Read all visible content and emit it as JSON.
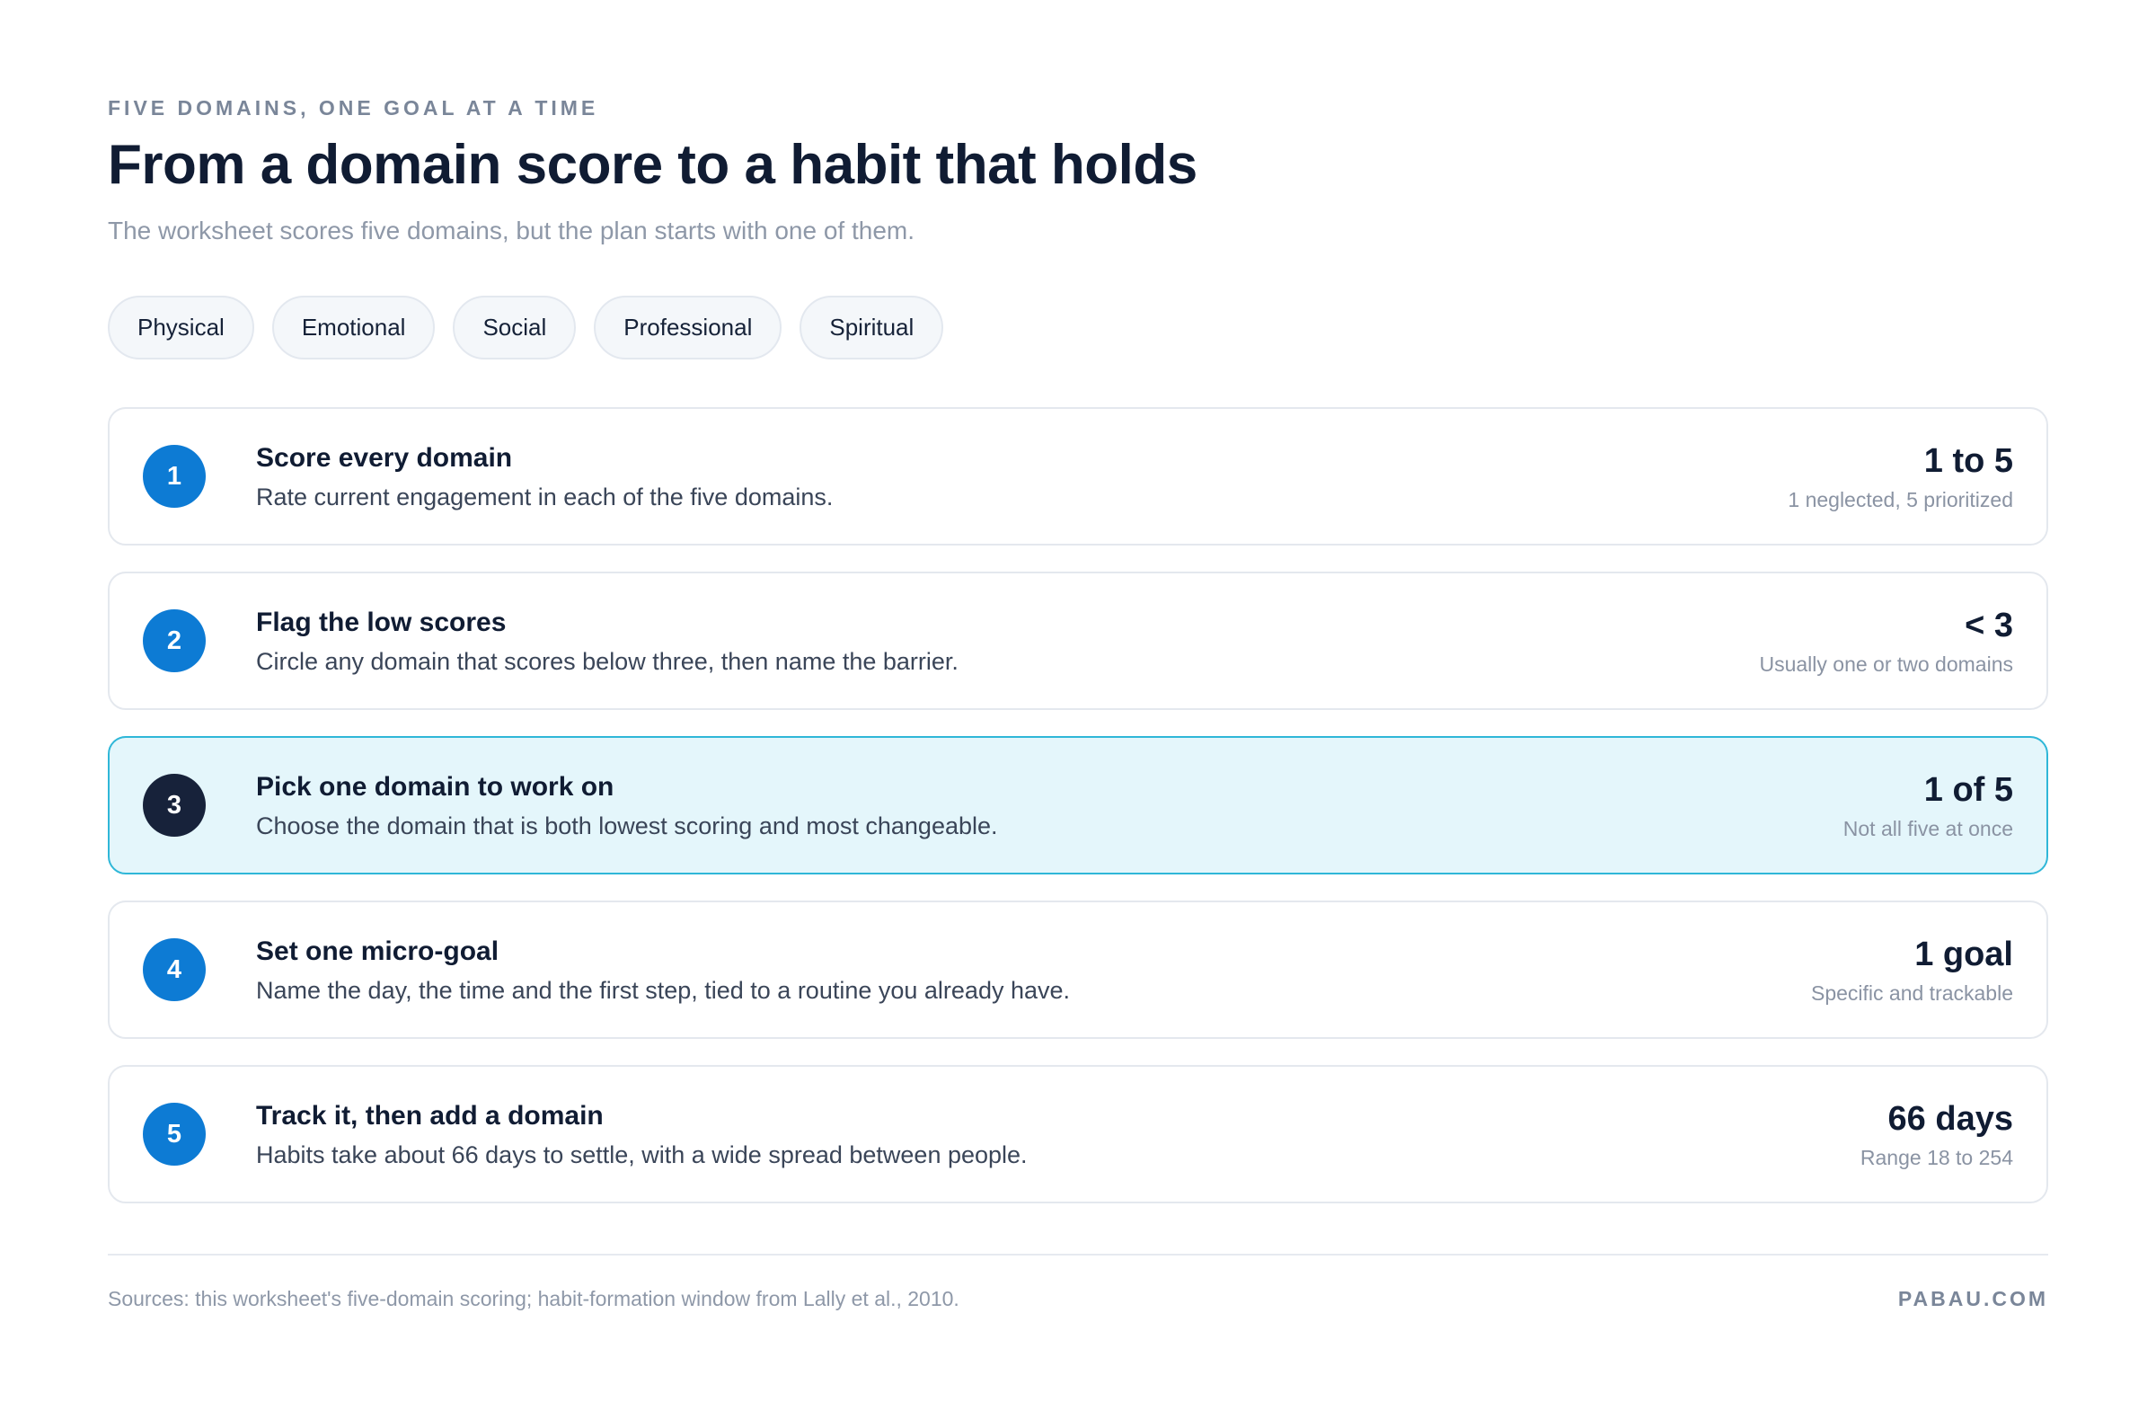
{
  "header": {
    "eyebrow": "FIVE DOMAINS, ONE GOAL AT A TIME",
    "title": "From a domain score to a habit that holds",
    "subtitle": "The worksheet scores five domains, but the plan starts with one of them."
  },
  "domains": [
    "Physical",
    "Emotional",
    "Social",
    "Professional",
    "Spiritual"
  ],
  "steps": [
    {
      "number": "1",
      "title": "Score every domain",
      "description": "Rate current engagement in each of the five domains.",
      "value": "1 to 5",
      "caption": "1 neglected, 5 prioritized"
    },
    {
      "number": "2",
      "title": "Flag the low scores",
      "description": "Circle any domain that scores below three, then name the barrier.",
      "value": "< 3",
      "caption": "Usually one or two domains"
    },
    {
      "number": "3",
      "title": "Pick one domain to work on",
      "description": "Choose the domain that is both lowest scoring and most changeable.",
      "value": "1 of 5",
      "caption": "Not all five at once"
    },
    {
      "number": "4",
      "title": "Set one micro-goal",
      "description": "Name the day, the time and the first step, tied to a routine you already have.",
      "value": "1 goal",
      "caption": "Specific and trackable"
    },
    {
      "number": "5",
      "title": "Track it, then add a domain",
      "description": "Habits take about 66 days to settle, with a wide spread between people.",
      "value": "66 days",
      "caption": "Range 18 to 254"
    }
  ],
  "colors": {
    "accent": "#0d7bd4",
    "highlight_bg": "#e4f6fb",
    "highlight_border": "#2fb7d8",
    "highlight_number": "#17223a"
  },
  "footer": {
    "sources": "Sources: this worksheet's five-domain scoring; habit-formation window from Lally et al., 2010.",
    "brand": "PABAU.COM"
  }
}
